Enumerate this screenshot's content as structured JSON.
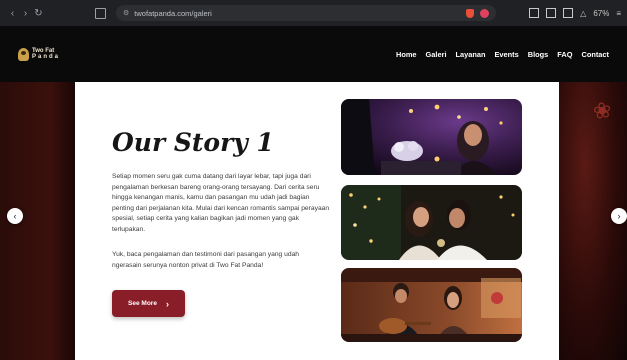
{
  "browser": {
    "url": "twofatpanda.com/galeri",
    "zoom": "67%"
  },
  "header": {
    "logo_line1": "Two Fat",
    "logo_line2": "Panda",
    "nav": [
      "Home",
      "Galeri",
      "Layanan",
      "Events",
      "Blogs",
      "FAQ",
      "Contact"
    ]
  },
  "story": {
    "title": "Our Story 1",
    "paragraph1": "Setiap momen seru gak cuma datang dari layar lebar, tapi juga dari pengalaman berkesan bareng orang-orang tersayang. Dari cerita seru hingga kenangan manis, kamu dan pasangan mu udah jadi bagian penting dari perjalanan kita. Mulai dari kencan romantis sampai perayaan spesial, setiap cerita yang kalian bagikan jadi momen yang gak terlupakan.",
    "paragraph2": "Yuk, baca pengalaman dan testimoni dari pasangan yang udah ngerasain serunya nonton privat di Two Fat Panda!",
    "button_label": "See More",
    "button_icon": "chevron-right-icon"
  },
  "carousel": {
    "prev_icon": "chevron-left-icon",
    "next_icon": "chevron-right-icon"
  },
  "colors": {
    "accent": "#8a1e28",
    "header_bg": "#0a0a0a",
    "card_bg": "#ffffff"
  }
}
